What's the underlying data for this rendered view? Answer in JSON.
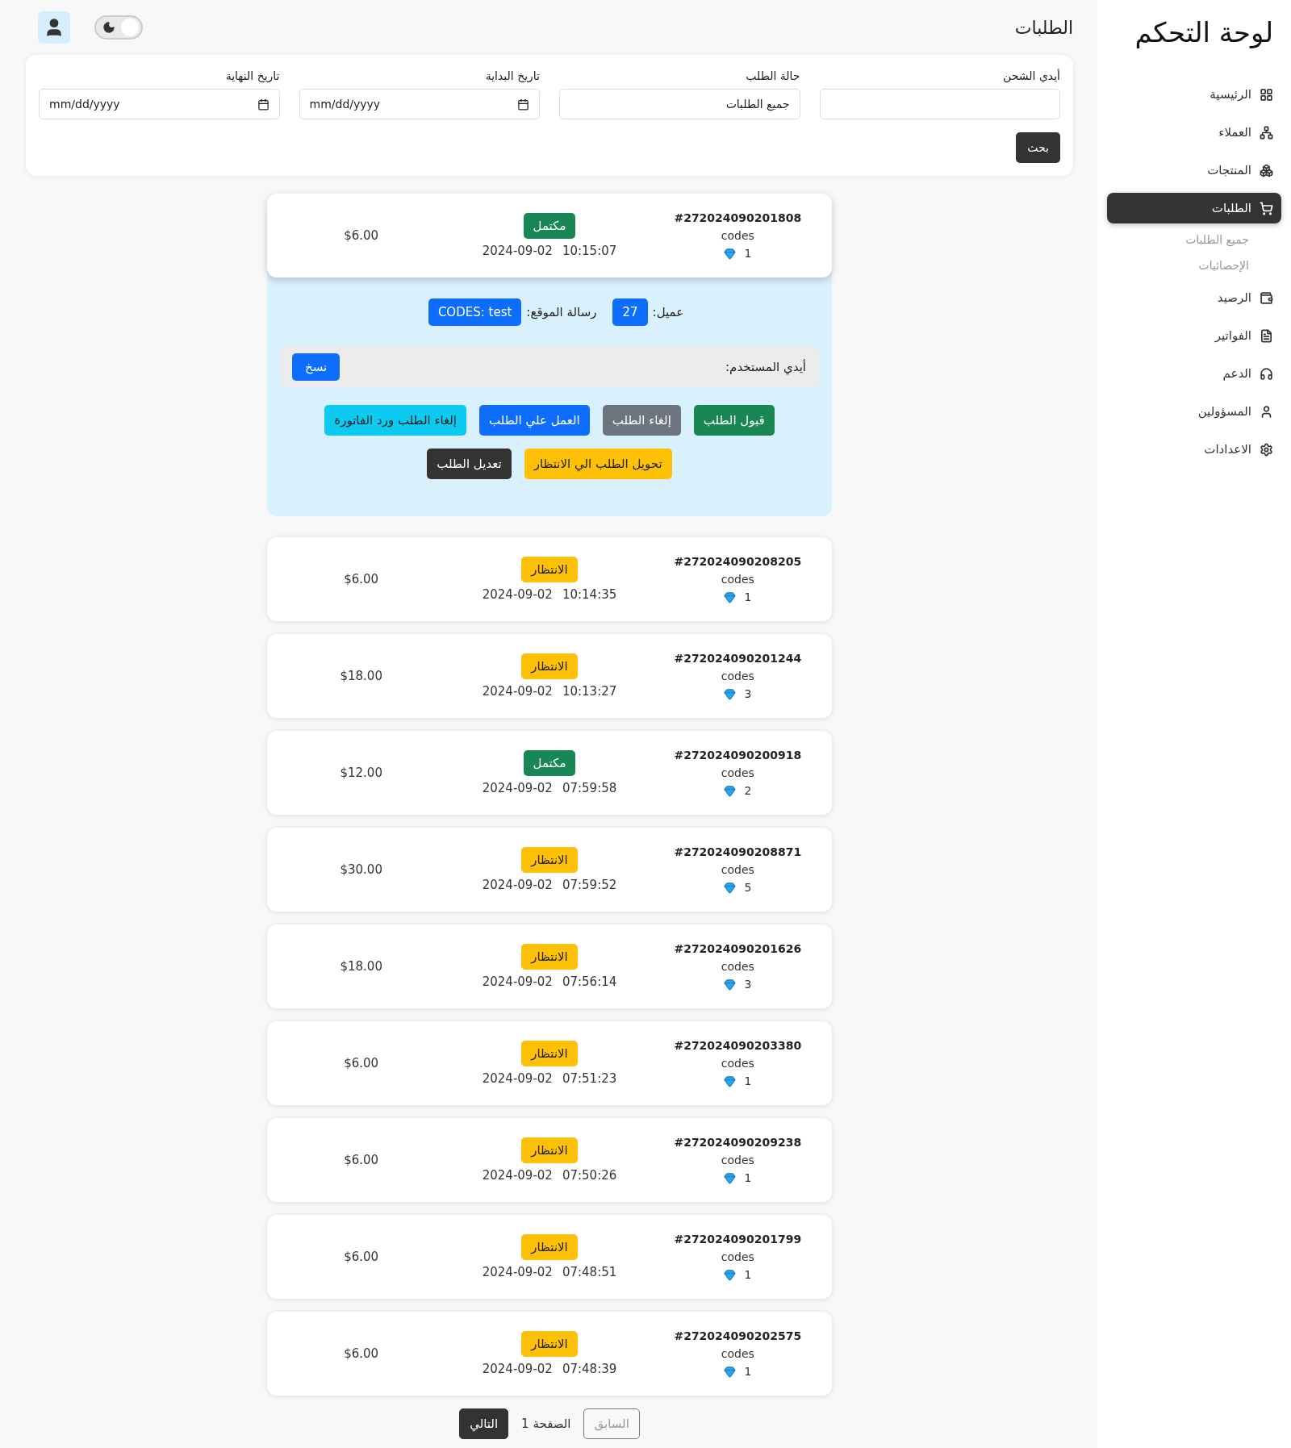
{
  "sidebar": {
    "title": "لوحة التحكم",
    "items": [
      {
        "label": "الرئيسية",
        "selected": false
      },
      {
        "label": "العملاء",
        "selected": false
      },
      {
        "label": "المنتجات",
        "selected": false
      },
      {
        "label": "الطلبات",
        "selected": true,
        "children": [
          {
            "label": "جميع الطلبات"
          },
          {
            "label": "الإحصائيات"
          }
        ]
      },
      {
        "label": "الرصيد",
        "selected": false
      },
      {
        "label": "الفواتير",
        "selected": false
      },
      {
        "label": "الدعم",
        "selected": false
      },
      {
        "label": "المسؤولين",
        "selected": false
      },
      {
        "label": "الاعدادات",
        "selected": false
      }
    ]
  },
  "header": {
    "title": "الطلبات",
    "theme_switch": {
      "on": true
    }
  },
  "filters": {
    "fields": [
      {
        "label": "أيدي الشحن",
        "kind": "text"
      },
      {
        "label": "حالة الطلب",
        "kind": "select",
        "value": "جميع الطلبات"
      },
      {
        "label": "تاريخ البداية",
        "kind": "date",
        "placeholder": "mm/dd/yyyy"
      },
      {
        "label": "تاريخ النهاية",
        "kind": "date",
        "placeholder": "mm/dd/yyyy"
      }
    ],
    "search_button": "بحث"
  },
  "orders": [
    {
      "id": "#272024090201808",
      "product": "codes",
      "quantity": "1",
      "status": "مكتمل",
      "kind": "completed",
      "date": "2024-09-02",
      "time": "10:15:07",
      "price": "$6.00",
      "expanded": true,
      "details": {
        "client_label": "عميل:",
        "client": "27",
        "message_label": "رسالة الموقع:",
        "message": "CODES: test",
        "user_id_label": "أيدي المستخدم:",
        "copy_button": "نسخ",
        "actions": [
          {
            "label": "قبول الطلب",
            "kind": "success"
          },
          {
            "label": "إلغاء الطلب",
            "kind": "secondary"
          },
          {
            "label": "العمل علي الطلب",
            "kind": "primary"
          },
          {
            "label": "إلغاء الطلب ورد الفاتورة",
            "kind": "info"
          },
          {
            "label": "تحويل الطلب الي الانتظار",
            "kind": "warning"
          },
          {
            "label": "تعديل الطلب",
            "kind": "dark"
          }
        ]
      }
    },
    {
      "id": "#272024090208205",
      "product": "codes",
      "quantity": "1",
      "status": "الانتظار",
      "kind": "pending",
      "date": "2024-09-02",
      "time": "10:14:35",
      "price": "$6.00",
      "expanded": false
    },
    {
      "id": "#272024090201244",
      "product": "codes",
      "quantity": "3",
      "status": "الانتظار",
      "kind": "pending",
      "date": "2024-09-02",
      "time": "10:13:27",
      "price": "$18.00",
      "expanded": false
    },
    {
      "id": "#272024090200918",
      "product": "codes",
      "quantity": "2",
      "status": "مكتمل",
      "kind": "completed",
      "date": "2024-09-02",
      "time": "07:59:58",
      "price": "$12.00",
      "expanded": false
    },
    {
      "id": "#272024090208871",
      "product": "codes",
      "quantity": "5",
      "status": "الانتظار",
      "kind": "pending",
      "date": "2024-09-02",
      "time": "07:59:52",
      "price": "$30.00",
      "expanded": false
    },
    {
      "id": "#272024090201626",
      "product": "codes",
      "quantity": "3",
      "status": "الانتظار",
      "kind": "pending",
      "date": "2024-09-02",
      "time": "07:56:14",
      "price": "$18.00",
      "expanded": false
    },
    {
      "id": "#272024090203380",
      "product": "codes",
      "quantity": "1",
      "status": "الانتظار",
      "kind": "pending",
      "date": "2024-09-02",
      "time": "07:51:23",
      "price": "$6.00",
      "expanded": false
    },
    {
      "id": "#272024090209238",
      "product": "codes",
      "quantity": "1",
      "status": "الانتظار",
      "kind": "pending",
      "date": "2024-09-02",
      "time": "07:50:26",
      "price": "$6.00",
      "expanded": false
    },
    {
      "id": "#272024090201799",
      "product": "codes",
      "quantity": "1",
      "status": "الانتظار",
      "kind": "pending",
      "date": "2024-09-02",
      "time": "07:48:51",
      "price": "$6.00",
      "expanded": false
    },
    {
      "id": "#272024090202575",
      "product": "codes",
      "quantity": "1",
      "status": "الانتظار",
      "kind": "pending",
      "date": "2024-09-02",
      "time": "07:48:39",
      "price": "$6.00",
      "expanded": false
    }
  ],
  "pagination": {
    "previous": {
      "label": "السابق",
      "disabled": true
    },
    "page": "الصفحة 1",
    "next": {
      "label": "التالي",
      "disabled": false
    }
  }
}
